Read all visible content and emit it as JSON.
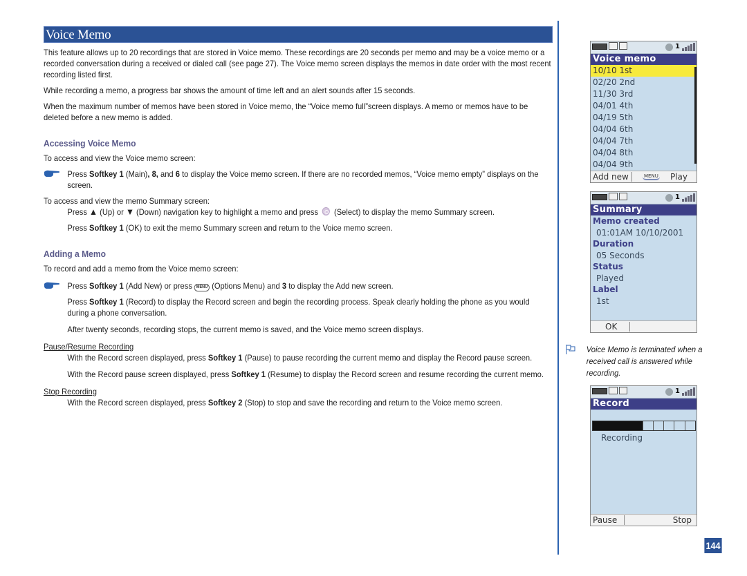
{
  "section_title": "Voice Memo",
  "intro": [
    "This feature allows up to 20 recordings that are stored in Voice memo. These recordings are 20 seconds per memo and may be a voice memo or a recorded conversation during a received or dialed call (see page 27). The Voice memo screen displays the memos in date order with the most recent recording listed first.",
    "While recording a memo, a progress bar shows the amount of time left and an alert sounds after 15 seconds.",
    "When the maximum number of memos have been stored in Voice memo, the “Voice memo full”screen displays. A memo or memos have to be deleted before a new memo is added."
  ],
  "accessing": {
    "heading": "Accessing Voice Memo",
    "lead": "To access and view the Voice memo screen:",
    "step1": {
      "pre": "Press ",
      "key": "Softkey 1",
      "mid": " (Main)",
      "keys2": ", 8,",
      "and": " and ",
      "key3": "6",
      "post": " to display the Voice memo screen. If there are no recorded memos, “Voice memo empty” displays on the screen."
    },
    "summary_lead": "To access and view the memo Summary screen:",
    "step2": {
      "pre": "Press ",
      "up": "▲",
      "mid1": " (Up) or ",
      "down": "▼",
      "mid2": " (Down) navigation key to highlight a memo and press ",
      "post": " (Select) to display the memo Summary screen."
    },
    "step3": {
      "pre": "Press ",
      "key": "Softkey 1",
      "post": " (OK) to exit the memo Summary screen and return to the Voice memo screen."
    }
  },
  "adding": {
    "heading": "Adding a Memo",
    "lead": "To record and add a memo from the Voice memo screen:",
    "step1": {
      "pre": "Press ",
      "key": "Softkey 1",
      "mid": " (Add New) or press ",
      "menu_key": "MENU",
      "mid2": " (Options Menu) and ",
      "key2": "3",
      "post": " to display the Add new screen."
    },
    "step2": {
      "pre": "Press ",
      "key": "Softkey 1",
      "post": " (Record) to display the Record screen and begin the recording process. Speak clearly holding the phone as you would during a phone conversation."
    },
    "step3": "After twenty seconds, recording stops, the current memo is saved, and the Voice memo screen displays.",
    "pause_heading": "Pause/Resume Recording",
    "pause1": {
      "pre": "With the Record screen displayed, press ",
      "key": "Softkey 1",
      "post": " (Pause) to pause recording the current memo and display the Record pause screen."
    },
    "pause2": {
      "pre": "With the Record pause screen displayed, press ",
      "key": "Softkey 1",
      "post": " (Resume) to display the Record screen and resume recording the current memo."
    },
    "stop_heading": "Stop Recording",
    "stop1": {
      "pre": "With the Record screen displayed, press ",
      "key": "Softkey 2",
      "post": " (Stop) to stop and save the recording and return to the Voice memo screen."
    }
  },
  "screens": {
    "voice_memo": {
      "status_call_line": "1",
      "title": "Voice memo",
      "items": [
        "10/10 1st",
        "02/20 2nd",
        "11/30 3rd",
        "04/01 4th",
        "04/19 5th",
        "04/04 6th",
        "04/04 7th",
        "04/04 8th",
        "04/04 9th"
      ],
      "selected_index": 0,
      "softkey_left": "Add new",
      "softkey_menu": "MENU",
      "softkey_right": "Play"
    },
    "summary": {
      "status_call_line": "1",
      "title": "Summary",
      "fields": [
        {
          "label": "Memo created",
          "value": "01:01AM 10/10/2001"
        },
        {
          "label": "Duration",
          "value": "05 Seconds"
        },
        {
          "label": "Status",
          "value": "Played"
        },
        {
          "label": "Label",
          "value": "1st"
        }
      ],
      "softkey_left": "OK"
    },
    "record": {
      "status_call_line": "1",
      "title": "Record",
      "progress_filled_segments": 5,
      "progress_total_segments": 10,
      "status_text": "Recording",
      "softkey_left": "Pause",
      "softkey_right": "Stop"
    }
  },
  "note": "Voice Memo is terminated when a received call is answered while recording.",
  "page_number": "144",
  "colors": {
    "title_bar": "#2b5295",
    "section_heading": "#5a5a8a",
    "divider": "#2b62b0",
    "phone_header": "#3d3f87",
    "phone_bg": "#c8dcec",
    "selected_item": "#f7ea3c"
  }
}
